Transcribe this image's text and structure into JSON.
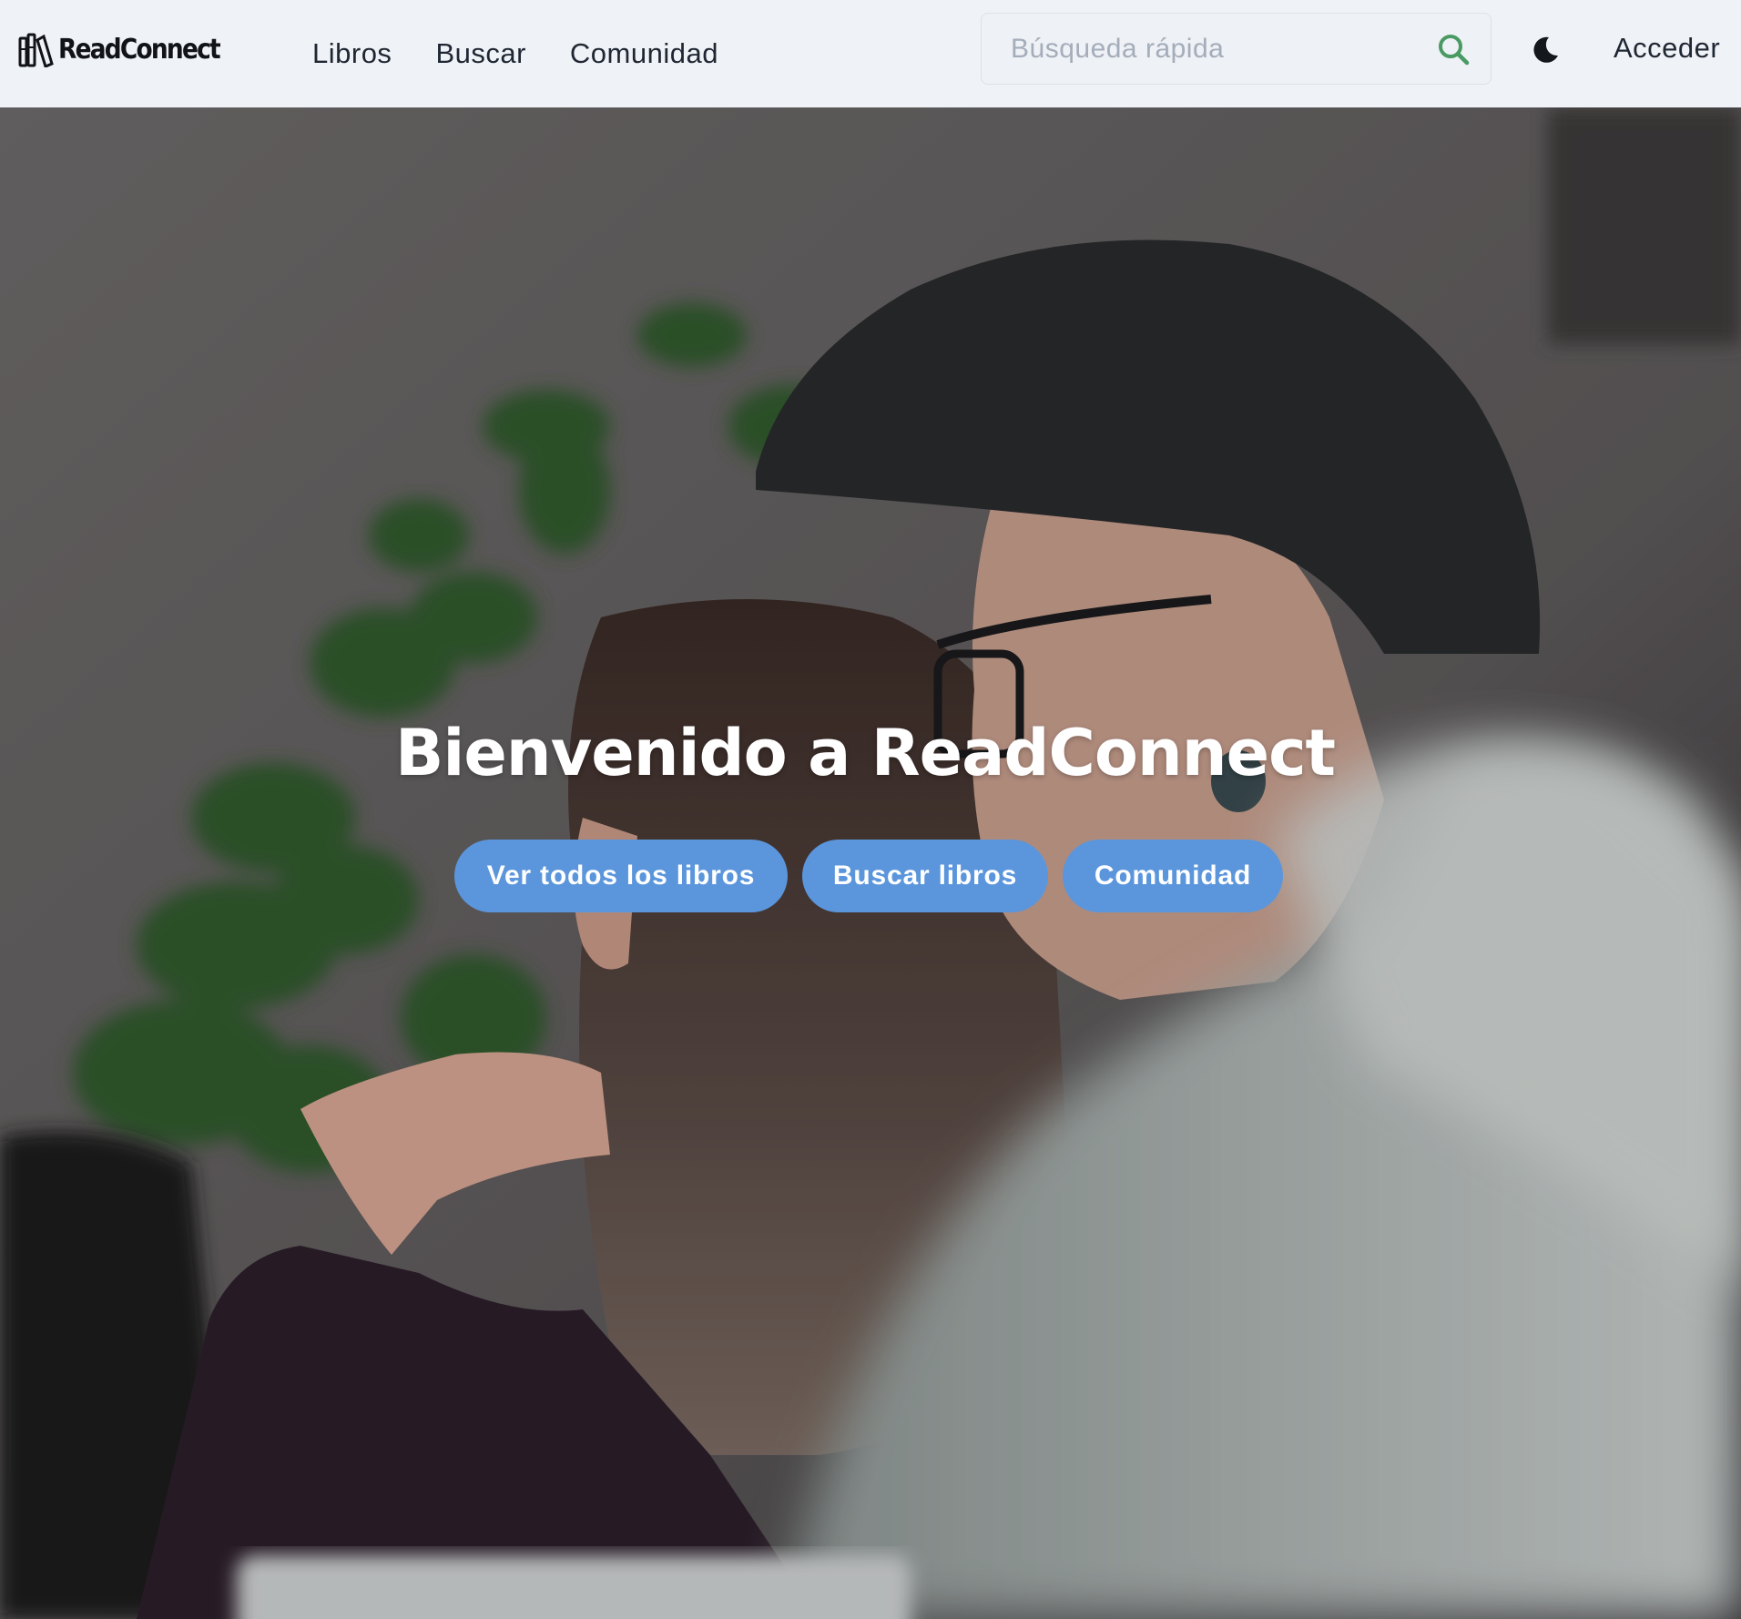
{
  "brand": {
    "name": "ReadConnect",
    "logo_icon": "books-icon"
  },
  "nav": {
    "links": [
      {
        "label": "Libros"
      },
      {
        "label": "Buscar"
      },
      {
        "label": "Comunidad"
      }
    ],
    "login_label": "Acceder"
  },
  "search": {
    "placeholder": "Búsqueda rápida",
    "value": "",
    "icon": "search-icon",
    "icon_color": "#4a9a63"
  },
  "theme_toggle": {
    "icon": "moon-icon"
  },
  "hero": {
    "title": "Bienvenido a ReadConnect",
    "buttons": [
      {
        "label": "Ver todos los libros"
      },
      {
        "label": "Buscar libros"
      },
      {
        "label": "Comunidad"
      }
    ],
    "button_color": "#5b96dc"
  },
  "colors": {
    "navbar_bg": "#eff2f6",
    "text_dark": "#1f2733",
    "accent_green": "#4a9a63"
  }
}
